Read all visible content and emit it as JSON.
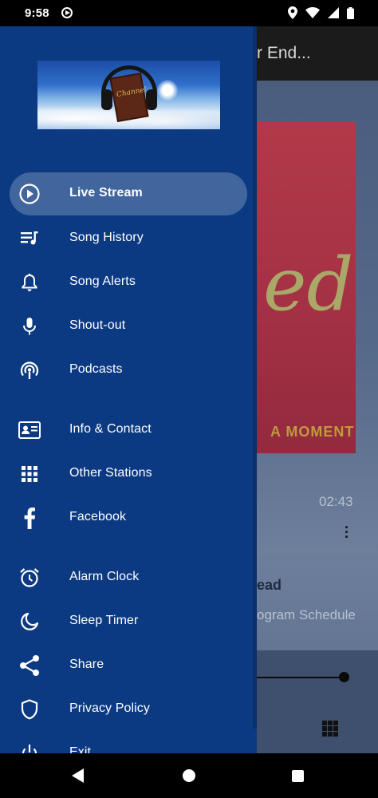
{
  "status_bar": {
    "time": "9:58"
  },
  "background_app": {
    "toolbar_title": "r End...",
    "artwork_text": "ed",
    "artwork_subtext": "A MOMENT",
    "time": "02:43",
    "artist": "ead",
    "schedule_link": "ogram Schedule"
  },
  "drawer": {
    "logo_text": "Channel",
    "items": [
      {
        "label": "Live Stream",
        "icon": "play-circle-icon",
        "active": true
      },
      {
        "label": "Song History",
        "icon": "queue-music-icon"
      },
      {
        "label": "Song Alerts",
        "icon": "bell-icon"
      },
      {
        "label": "Shout-out",
        "icon": "microphone-icon"
      },
      {
        "label": "Podcasts",
        "icon": "podcast-icon"
      },
      {
        "label": "Info & Contact",
        "icon": "contact-card-icon"
      },
      {
        "label": "Other Stations",
        "icon": "grid-icon"
      },
      {
        "label": "Facebook",
        "icon": "facebook-icon"
      },
      {
        "label": "Alarm Clock",
        "icon": "alarm-clock-icon"
      },
      {
        "label": "Sleep Timer",
        "icon": "moon-icon"
      },
      {
        "label": "Share",
        "icon": "share-icon"
      },
      {
        "label": "Privacy Policy",
        "icon": "shield-icon"
      },
      {
        "label": "Exit",
        "icon": "power-icon"
      }
    ]
  }
}
